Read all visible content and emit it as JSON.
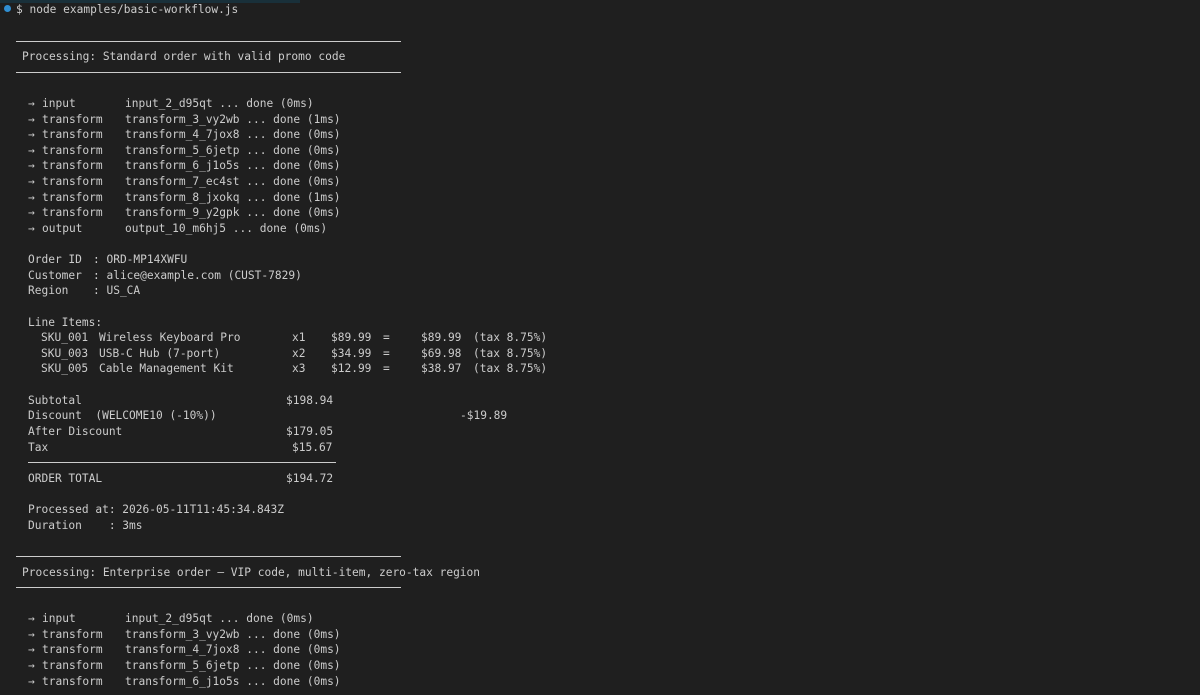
{
  "prompt": "$ node examples/basic-workflow.js",
  "blocks": [
    {
      "title": "Processing: Standard order with valid promo code",
      "steps": [
        {
          "arrow": "→",
          "kind": "input",
          "text": "input_2_d95qt ... done (0ms)"
        },
        {
          "arrow": "→",
          "kind": "transform",
          "text": "transform_3_vy2wb ... done (1ms)"
        },
        {
          "arrow": "→",
          "kind": "transform",
          "text": "transform_4_7jox8 ... done (0ms)"
        },
        {
          "arrow": "→",
          "kind": "transform",
          "text": "transform_5_6jetp ... done (0ms)"
        },
        {
          "arrow": "→",
          "kind": "transform",
          "text": "transform_6_j1o5s ... done (0ms)"
        },
        {
          "arrow": "→",
          "kind": "transform",
          "text": "transform_7_ec4st ... done (0ms)"
        },
        {
          "arrow": "→",
          "kind": "transform",
          "text": "transform_8_jxokq ... done (1ms)"
        },
        {
          "arrow": "→",
          "kind": "transform",
          "text": "transform_9_y2gpk ... done (0ms)"
        },
        {
          "arrow": "→",
          "kind": "output",
          "text": "output_10_m6hj5 ... done (0ms)"
        }
      ],
      "meta": [
        {
          "label": "Order ID",
          "value": ": ORD-MP14XWFU"
        },
        {
          "label": "Customer",
          "value": ": alice@example.com (CUST-7829)"
        },
        {
          "label": "Region",
          "value": ": US_CA"
        }
      ],
      "line_items_label": "Line Items:",
      "items": [
        {
          "sku": "SKU_001",
          "name": "Wireless Keyboard Pro",
          "qty": "x1",
          "price": "$89.99",
          "eq": "=",
          "total": "$89.99",
          "tax": "(tax 8.75%)"
        },
        {
          "sku": "SKU_003",
          "name": "USB-C Hub (7-port)",
          "qty": "x2",
          "price": "$34.99",
          "eq": "=",
          "total": "$69.98",
          "tax": "(tax 8.75%)"
        },
        {
          "sku": "SKU_005",
          "name": "Cable Management Kit",
          "qty": "x3",
          "price": "$12.99",
          "eq": "=",
          "total": "$38.97",
          "tax": "(tax 8.75%)"
        }
      ],
      "subtotal_label": "Subtotal",
      "subtotal": "$198.94",
      "discount_label": "Discount  (WELCOME10 (-10%))",
      "discount": "-$19.89",
      "after_discount_label": "After Discount",
      "after_discount": "$179.05",
      "tax_label": "Tax",
      "tax": "$15.67",
      "order_total_label": "ORDER TOTAL",
      "order_total": "$194.72",
      "processed_at": "Processed at: 2026-05-11T11:45:34.843Z",
      "duration": "Duration    : 3ms"
    },
    {
      "title": "Processing: Enterprise order — VIP code, multi-item, zero-tax region",
      "steps": [
        {
          "arrow": "→",
          "kind": "input",
          "text": "input_2_d95qt ... done (0ms)"
        },
        {
          "arrow": "→",
          "kind": "transform",
          "text": "transform_3_vy2wb ... done (0ms)"
        },
        {
          "arrow": "→",
          "kind": "transform",
          "text": "transform_4_7jox8 ... done (0ms)"
        },
        {
          "arrow": "→",
          "kind": "transform",
          "text": "transform_5_6jetp ... done (0ms)"
        },
        {
          "arrow": "→",
          "kind": "transform",
          "text": "transform_6_j1o5s ... done (0ms)"
        }
      ]
    }
  ]
}
